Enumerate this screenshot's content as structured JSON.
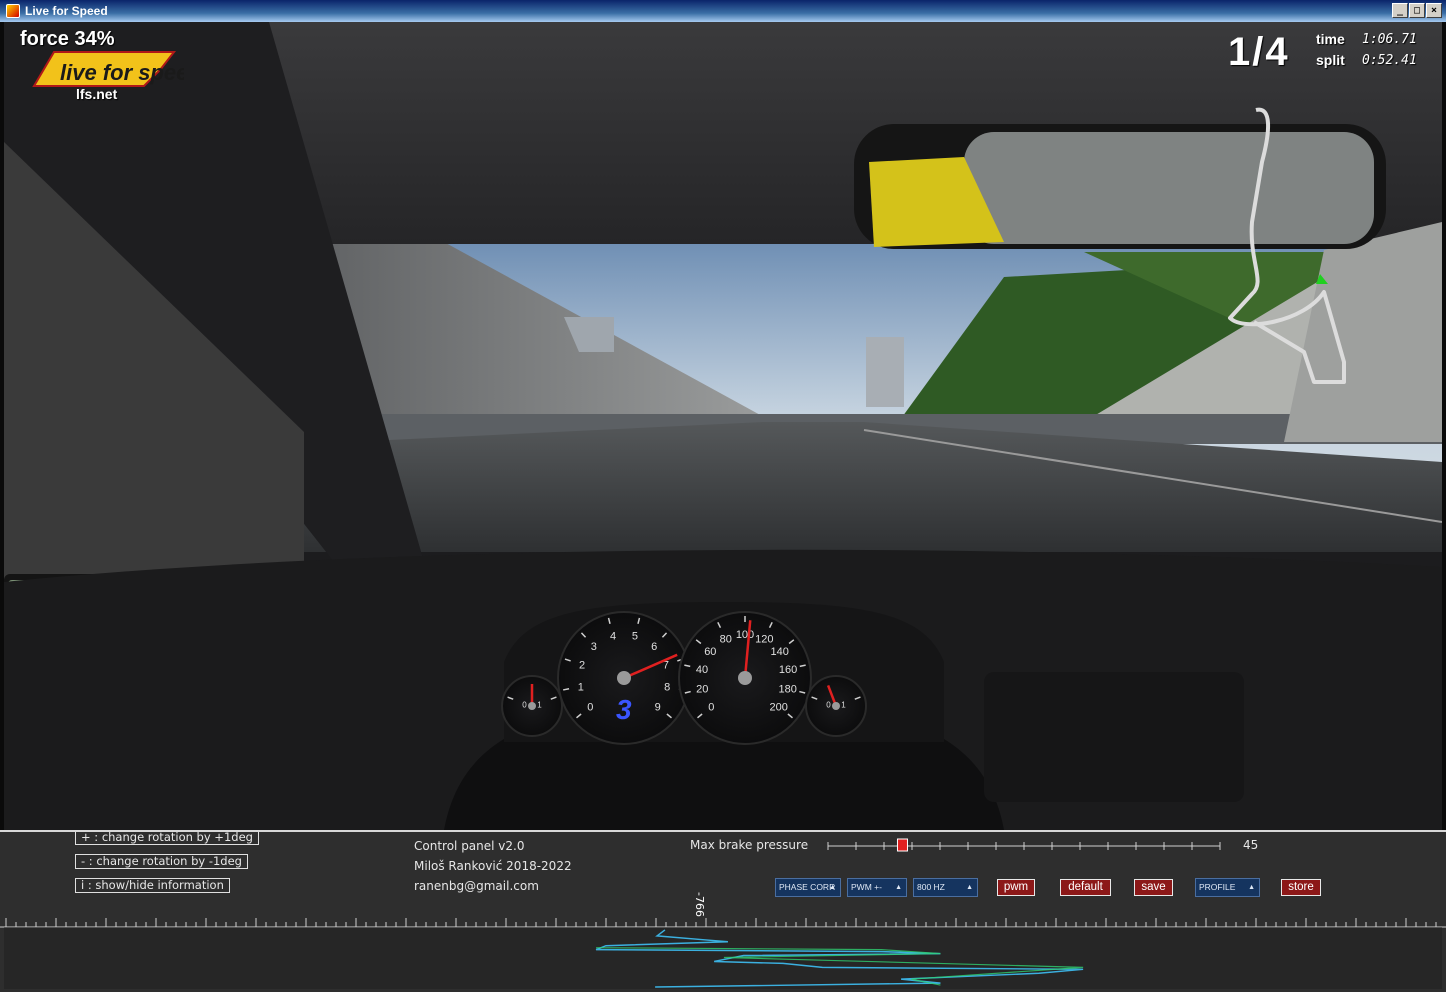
{
  "window": {
    "title": "Live for Speed",
    "buttons": [
      "_",
      "□",
      "×"
    ]
  },
  "hud": {
    "force": "force 34%",
    "logo_text": "live for speed",
    "url": "lfs.net",
    "lap": "1/4",
    "time_label": "time",
    "time_value": "1:06.71",
    "split_label": "split",
    "split_value": "0:52.41"
  },
  "dashboard": {
    "tacho_labels": [
      "0",
      "1",
      "2",
      "3",
      "4",
      "5",
      "6",
      "7",
      "8",
      "9"
    ],
    "speedo_labels": [
      "0",
      "20",
      "40",
      "60",
      "80",
      "100",
      "120",
      "140",
      "160",
      "180",
      "200"
    ],
    "gear": "3",
    "temp_labels": [
      "0",
      "1"
    ],
    "fuel_labels": [
      "0",
      "1"
    ],
    "rpm": 6.8,
    "speed": 104
  },
  "panel": {
    "hints": {
      "plus": "+ : change rotation by +1deg",
      "minus": "- : change rotation by -1deg",
      "info": "i : show/hide information"
    },
    "title": "Control panel v2.0",
    "author": "Miloš Ranković 2018-2022",
    "email": "ranenbg@gmail.com",
    "brake_label": "Max brake pressure",
    "brake_value": "45",
    "brake_fraction": 0.19,
    "rotation_value": "-766",
    "dropdowns": {
      "phase": "PHASE CORR",
      "pwm": "PWM +-",
      "hz": "800 HZ",
      "profile": "PROFILE"
    },
    "buttons": {
      "pwm": "pwm",
      "default": "default",
      "save": "save",
      "store": "store"
    }
  },
  "colors": {
    "button_red": "#8c1818",
    "dropdown_blue": "#15345f",
    "panel_bg": "#2e2e2e",
    "needle": "#e02020"
  }
}
